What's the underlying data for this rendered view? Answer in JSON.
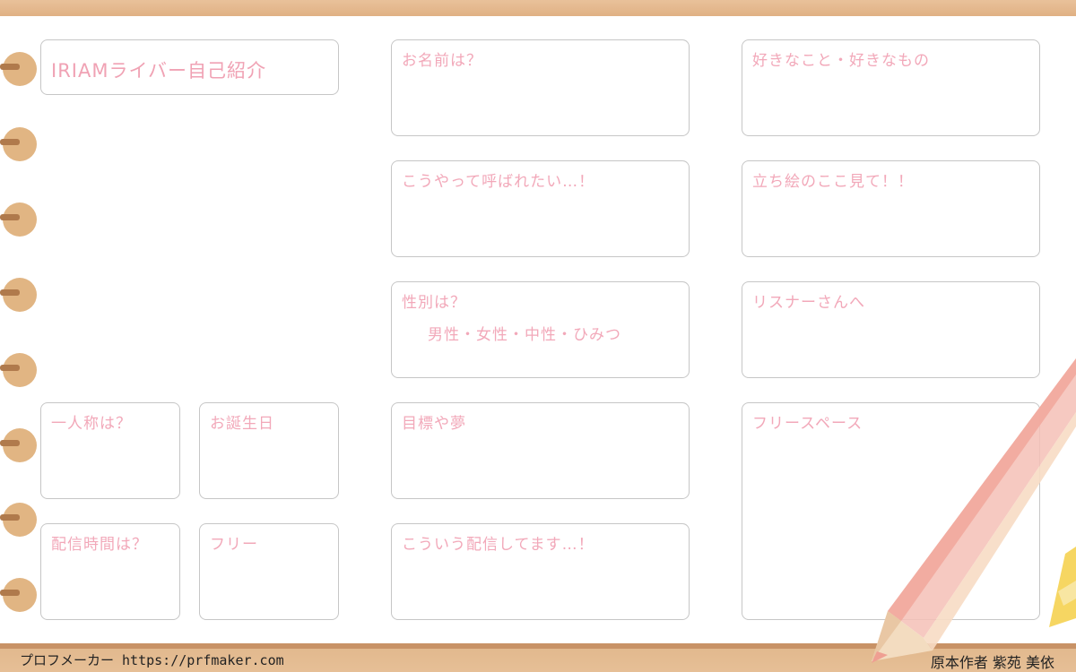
{
  "title": "IRIAMライバー自己紹介",
  "boxes": {
    "name": "お名前は？",
    "nickname": "こうやって呼ばれたい…！",
    "gender": "性別は？",
    "gender_options": "男性・女性・中性・ひみつ",
    "goal": "目標や夢",
    "streaming_content": "こういう配信してます…！",
    "first_person": "一人称は？",
    "birthday": "お誕生日",
    "stream_time": "配信時間は？",
    "free_small": "フリー",
    "likes": "好きなこと・好きなもの",
    "portrait": "立ち絵のここ見て！！",
    "to_listeners": "リスナーさんへ",
    "free_space": "フリースペース"
  },
  "footer": {
    "left": "プロフメーカー https://prfmaker.com",
    "right": "原本作者 紫苑 美依"
  },
  "colors": {
    "label_pink": "#f2a8b9",
    "band_tan": "#e6bf96",
    "pencil_pink": "#f5bfb6"
  }
}
